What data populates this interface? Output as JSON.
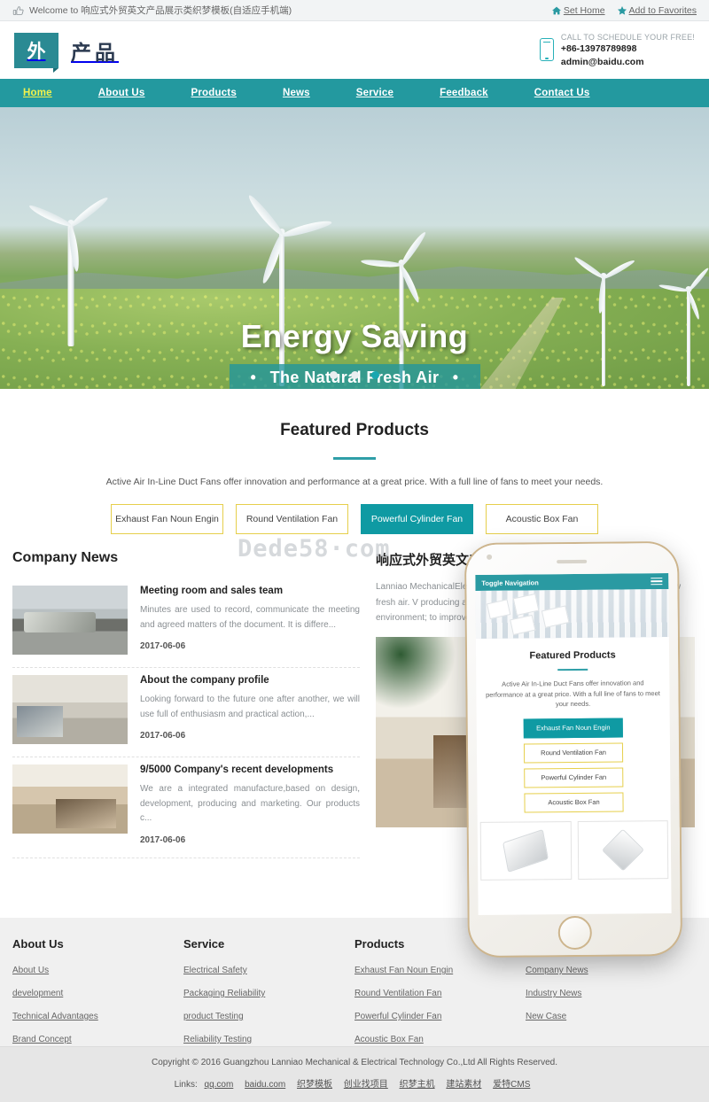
{
  "topbar": {
    "welcome": "Welcome to 响应式外贸英文产品展示类织梦模板(自适应手机端)",
    "set_home": "Set Home",
    "add_favorites": "Add to Favorites",
    "thumb_icon": "thumbs-up-icon",
    "home_icon": "home-icon",
    "star_icon": "star-icon"
  },
  "header": {
    "logo_badge": "外",
    "logo_text": "产品",
    "phone_icon": "mobile-phone-icon",
    "call_label": "CALL TO SCHEDULE YOUR FREE!",
    "phone_number": "+86-13978789898",
    "email": "admin@baidu.com"
  },
  "nav": {
    "items": [
      {
        "label": "Home",
        "active": true
      },
      {
        "label": "About Us",
        "active": false
      },
      {
        "label": "Products",
        "active": false
      },
      {
        "label": "News",
        "active": false
      },
      {
        "label": "Service",
        "active": false
      },
      {
        "label": "Feedback",
        "active": false
      },
      {
        "label": "Contact Us",
        "active": false
      }
    ]
  },
  "hero": {
    "title": "Energy Saving",
    "subtitle": "The Natural Fresh Air",
    "bullet": "•",
    "slides_total": 3,
    "active_slide": 3
  },
  "featured": {
    "title": "Featured Products",
    "description": "Active Air In-Line Duct Fans offer innovation and performance at a great price. With a full line of fans to meet your needs.",
    "tabs": [
      {
        "label": "Exhaust Fan Noun Engin",
        "active": false
      },
      {
        "label": "Round Ventilation Fan",
        "active": false
      },
      {
        "label": "Powerful Cylinder Fan",
        "active": true
      },
      {
        "label": "Acoustic Box Fan",
        "active": false
      }
    ]
  },
  "watermark": "Dede58·com",
  "news": {
    "section_title": "Company News",
    "items": [
      {
        "title": "Meeting room and sales team",
        "excerpt": "Minutes are used to record, communicate the meeting and agreed matters of the document. It is differe...",
        "date": "2017-06-06",
        "thumb": "meeting-room-photo"
      },
      {
        "title": "About the company profile",
        "excerpt": "Looking forward to the future one after another, we will use full of enthusiasm and practical action,...",
        "date": "2017-06-06",
        "thumb": "office-corridor-photo"
      },
      {
        "title": "9/5000 Company's recent developments",
        "excerpt": "We are a integrated manufacture,based on design, development, producing and marketing. Our products c...",
        "date": "2017-06-06",
        "thumb": "executive-office-photo"
      }
    ]
  },
  "about": {
    "section_title": "响应式外贸英文产品展",
    "paragraph": "Lanniao MechanicalElectrica ventilation appliances and eq air indoor and new fresh air. V producing and marketing. Ou The greatest compliment we environment; to improve the c varies with different customer",
    "image": "modern-office-interior-photo"
  },
  "phone_mockup": {
    "nav_label": "Toggle Navigation",
    "burger_icon": "hamburger-menu-icon",
    "title": "Featured Products",
    "description": "Active Air In-Line Duct Fans offer innovation and performance at a great price. With a full line of fans to meet your needs.",
    "tabs": [
      {
        "label": "Exhaust Fan Noun Engin",
        "active": true
      },
      {
        "label": "Round Ventilation Fan",
        "active": false
      },
      {
        "label": "Powerful Cylinder Fan",
        "active": false
      },
      {
        "label": "Acoustic Box Fan",
        "active": false
      }
    ],
    "cards": [
      "ceiling-fan-product-image",
      "square-diffuser-product-image"
    ]
  },
  "footer": {
    "columns": [
      {
        "heading": "About Us",
        "links": [
          "About Us",
          "development",
          "Technical Advantages",
          "Brand Concept"
        ]
      },
      {
        "heading": "Service",
        "links": [
          "Electrical Safety",
          "Packaging Reliability",
          "product Testing",
          "Reliability Testing"
        ]
      },
      {
        "heading": "Products",
        "links": [
          "Exhaust Fan Noun Engin",
          "Round Ventilation Fan",
          "Powerful Cylinder Fan",
          "Acoustic Box Fan"
        ]
      },
      {
        "heading": "",
        "links": [
          "Company News",
          "Industry News",
          "New Case"
        ]
      }
    ],
    "copyright": "Copyright © 2016 Guangzhou Lanniao Mechanical & Electrical Technology Co.,Ltd All Rights Reserved.",
    "links_label": "Links:",
    "links": [
      "qq.com",
      "baidu.com",
      "织梦模板",
      "创业找项目",
      "织梦主机",
      "建站素材",
      "爱特CMS"
    ]
  },
  "colors": {
    "brand_teal": "#23999f",
    "accent_yellow": "#e6cf4b",
    "active_tab": "#0f9aa3",
    "nav_active_text": "#f3f24a"
  }
}
